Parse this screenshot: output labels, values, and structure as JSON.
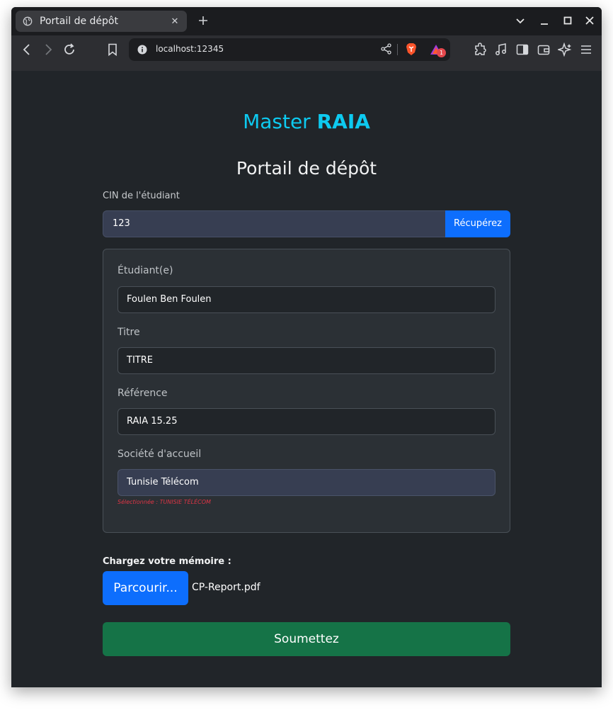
{
  "browser": {
    "tab_title": "Portail de dépôt",
    "url": "localhost:12345",
    "notification_count": "1"
  },
  "page": {
    "brand_prefix": "Master ",
    "brand_name": "RAIA",
    "title": "Portail de dépôt"
  },
  "cin": {
    "label": "CIN de l'étudiant",
    "value": "123",
    "button_label": "Récupérez"
  },
  "details": {
    "student_label": "Étudiant(e)",
    "student_value": "Foulen Ben Foulen",
    "title_label": "Titre",
    "title_value": "TITRE",
    "reference_label": "Référence",
    "reference_value": "RAIA 15.25",
    "company_label": "Société d'accueil",
    "company_value": "Tunisie Télécom",
    "selected_note": "Sélectionnée : TUNISIE TÉLÉCOM"
  },
  "upload": {
    "label": "Chargez votre mémoire :",
    "browse_label": "Parcourir...",
    "file_name": "CP-Report.pdf"
  },
  "submit_label": "Soumettez",
  "colors": {
    "brand": "#0dcaf0",
    "primary": "#0d6efd",
    "success": "#157347",
    "danger": "#dc3545",
    "background": "#212529"
  }
}
